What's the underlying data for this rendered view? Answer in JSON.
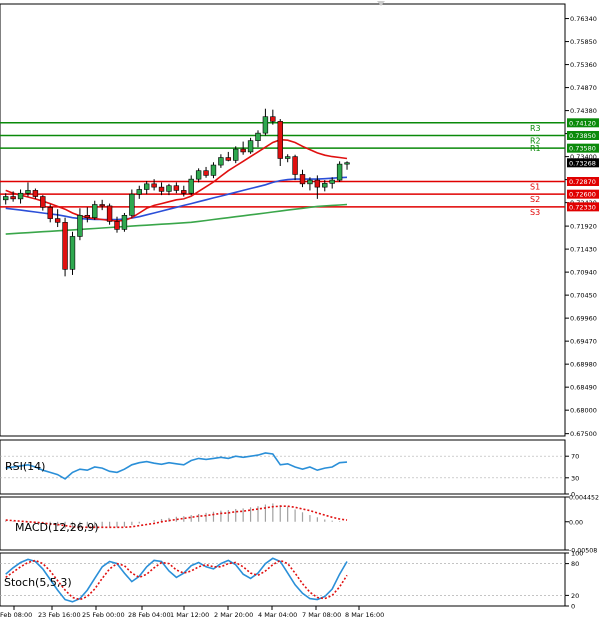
{
  "chart_data": {
    "type": "candlestick",
    "main": {
      "ylim": [
        0.6745,
        0.7665
      ],
      "y_ticks": [
        "0.76340",
        "0.75850",
        "0.75360",
        "0.74870",
        "0.74380",
        "0.73890",
        "0.73400",
        "0.72910",
        "0.72420",
        "0.71920",
        "0.71430",
        "0.70940",
        "0.70450",
        "0.69960",
        "0.69470",
        "0.68980",
        "0.68490",
        "0.68000",
        "0.67500"
      ],
      "last_price": {
        "value": 0.73268,
        "label": "0.73268"
      },
      "levels": [
        {
          "name": "R3",
          "value": 0.7412,
          "label": "0.74120",
          "color": "#0a8a0a"
        },
        {
          "name": "R2",
          "value": 0.7385,
          "label": "0.73850",
          "color": "#0a8a0a"
        },
        {
          "name": "R1",
          "value": 0.7358,
          "label": "0.73580",
          "color": "#0a8a0a"
        },
        {
          "name": "S1",
          "value": 0.7287,
          "label": "0.72870",
          "color": "#e00000"
        },
        {
          "name": "S2",
          "value": 0.726,
          "label": "0.72600",
          "color": "#e00000"
        },
        {
          "name": "S3",
          "value": 0.7233,
          "label": "0.72330",
          "color": "#e00000"
        }
      ],
      "candles": [
        {
          "o": 0.7248,
          "h": 0.7262,
          "l": 0.7238,
          "c": 0.7255
        },
        {
          "o": 0.7255,
          "h": 0.7266,
          "l": 0.7244,
          "c": 0.725
        },
        {
          "o": 0.725,
          "h": 0.727,
          "l": 0.724,
          "c": 0.7262
        },
        {
          "o": 0.7262,
          "h": 0.7285,
          "l": 0.7255,
          "c": 0.7268
        },
        {
          "o": 0.7268,
          "h": 0.7272,
          "l": 0.725,
          "c": 0.7255
        },
        {
          "o": 0.7255,
          "h": 0.7258,
          "l": 0.7225,
          "c": 0.7232
        },
        {
          "o": 0.7232,
          "h": 0.7238,
          "l": 0.72,
          "c": 0.7208
        },
        {
          "o": 0.7208,
          "h": 0.7228,
          "l": 0.719,
          "c": 0.72
        },
        {
          "o": 0.72,
          "h": 0.721,
          "l": 0.7085,
          "c": 0.71
        },
        {
          "o": 0.71,
          "h": 0.718,
          "l": 0.7088,
          "c": 0.717
        },
        {
          "o": 0.717,
          "h": 0.723,
          "l": 0.7162,
          "c": 0.7215
        },
        {
          "o": 0.7215,
          "h": 0.7232,
          "l": 0.72,
          "c": 0.721
        },
        {
          "o": 0.721,
          "h": 0.7246,
          "l": 0.7205,
          "c": 0.7238
        },
        {
          "o": 0.7238,
          "h": 0.7248,
          "l": 0.7226,
          "c": 0.7235
        },
        {
          "o": 0.7235,
          "h": 0.724,
          "l": 0.7195,
          "c": 0.7202
        },
        {
          "o": 0.7202,
          "h": 0.7212,
          "l": 0.7178,
          "c": 0.7185
        },
        {
          "o": 0.7185,
          "h": 0.722,
          "l": 0.718,
          "c": 0.7215
        },
        {
          "o": 0.7215,
          "h": 0.727,
          "l": 0.721,
          "c": 0.726
        },
        {
          "o": 0.726,
          "h": 0.7278,
          "l": 0.725,
          "c": 0.727
        },
        {
          "o": 0.727,
          "h": 0.7288,
          "l": 0.726,
          "c": 0.7282
        },
        {
          "o": 0.7282,
          "h": 0.7292,
          "l": 0.7268,
          "c": 0.7275
        },
        {
          "o": 0.7275,
          "h": 0.7285,
          "l": 0.7258,
          "c": 0.7266
        },
        {
          "o": 0.7266,
          "h": 0.7282,
          "l": 0.7258,
          "c": 0.7278
        },
        {
          "o": 0.7278,
          "h": 0.7285,
          "l": 0.7262,
          "c": 0.7268
        },
        {
          "o": 0.7268,
          "h": 0.7278,
          "l": 0.7255,
          "c": 0.7262
        },
        {
          "o": 0.7262,
          "h": 0.73,
          "l": 0.7258,
          "c": 0.7292
        },
        {
          "o": 0.7292,
          "h": 0.7315,
          "l": 0.7285,
          "c": 0.731
        },
        {
          "o": 0.731,
          "h": 0.7318,
          "l": 0.7295,
          "c": 0.73
        },
        {
          "o": 0.73,
          "h": 0.7328,
          "l": 0.7294,
          "c": 0.7322
        },
        {
          "o": 0.7322,
          "h": 0.7345,
          "l": 0.7316,
          "c": 0.7338
        },
        {
          "o": 0.7338,
          "h": 0.735,
          "l": 0.733,
          "c": 0.7332
        },
        {
          "o": 0.7332,
          "h": 0.7362,
          "l": 0.7326,
          "c": 0.7356
        },
        {
          "o": 0.7356,
          "h": 0.7372,
          "l": 0.7344,
          "c": 0.735
        },
        {
          "o": 0.735,
          "h": 0.738,
          "l": 0.7346,
          "c": 0.7374
        },
        {
          "o": 0.7374,
          "h": 0.7396,
          "l": 0.736,
          "c": 0.739
        },
        {
          "o": 0.739,
          "h": 0.7442,
          "l": 0.7385,
          "c": 0.7425
        },
        {
          "o": 0.7425,
          "h": 0.744,
          "l": 0.7408,
          "c": 0.7415
        },
        {
          "o": 0.7415,
          "h": 0.742,
          "l": 0.732,
          "c": 0.7336
        },
        {
          "o": 0.7336,
          "h": 0.7345,
          "l": 0.7328,
          "c": 0.734
        },
        {
          "o": 0.734,
          "h": 0.7344,
          "l": 0.729,
          "c": 0.7302
        },
        {
          "o": 0.7302,
          "h": 0.7312,
          "l": 0.7275,
          "c": 0.7282
        },
        {
          "o": 0.7282,
          "h": 0.7296,
          "l": 0.7268,
          "c": 0.729
        },
        {
          "o": 0.729,
          "h": 0.73,
          "l": 0.725,
          "c": 0.7275
        },
        {
          "o": 0.7275,
          "h": 0.729,
          "l": 0.7266,
          "c": 0.7283
        },
        {
          "o": 0.7283,
          "h": 0.7296,
          "l": 0.7272,
          "c": 0.729
        },
        {
          "o": 0.729,
          "h": 0.733,
          "l": 0.7286,
          "c": 0.7324
        },
        {
          "o": 0.7324,
          "h": 0.733,
          "l": 0.7312,
          "c": 0.7327
        }
      ],
      "ma_red": [
        0.7268,
        0.7262,
        0.7258,
        0.7254,
        0.725,
        0.7245,
        0.724,
        0.7234,
        0.7228,
        0.722,
        0.7214,
        0.721,
        0.7208,
        0.7206,
        0.7204,
        0.7203,
        0.7204,
        0.721,
        0.722,
        0.723,
        0.7236,
        0.724,
        0.7244,
        0.7248,
        0.725,
        0.7256,
        0.7266,
        0.7276,
        0.7286,
        0.7298,
        0.731,
        0.732,
        0.733,
        0.734,
        0.735,
        0.736,
        0.737,
        0.7376,
        0.7375,
        0.737,
        0.7362,
        0.7355,
        0.7348,
        0.7343,
        0.734,
        0.7338,
        0.7336
      ],
      "ma_blue": [
        0.723,
        0.7228,
        0.7226,
        0.7224,
        0.7222,
        0.722,
        0.7218,
        0.7216,
        0.7213,
        0.721,
        0.7208,
        0.7207,
        0.7206,
        0.7206,
        0.7206,
        0.7206,
        0.7207,
        0.7209,
        0.7212,
        0.7216,
        0.722,
        0.7224,
        0.7228,
        0.7232,
        0.7236,
        0.724,
        0.7244,
        0.7248,
        0.7252,
        0.7256,
        0.726,
        0.7264,
        0.7268,
        0.7272,
        0.7276,
        0.728,
        0.7285,
        0.7289,
        0.7291,
        0.7292,
        0.7292,
        0.7292,
        0.7292,
        0.7293,
        0.7294,
        0.7295,
        0.7296
      ],
      "ma_green": [
        0.7175,
        0.7176,
        0.7177,
        0.7178,
        0.7179,
        0.718,
        0.7181,
        0.7182,
        0.7183,
        0.7184,
        0.7185,
        0.7186,
        0.7187,
        0.7188,
        0.7189,
        0.719,
        0.7191,
        0.7192,
        0.7193,
        0.7194,
        0.7195,
        0.7196,
        0.7197,
        0.7198,
        0.7199,
        0.72,
        0.7202,
        0.7204,
        0.7206,
        0.7208,
        0.721,
        0.7212,
        0.7214,
        0.7216,
        0.7218,
        0.722,
        0.7222,
        0.7224,
        0.7226,
        0.7228,
        0.723,
        0.7232,
        0.7234,
        0.7235,
        0.7236,
        0.7237,
        0.7238
      ]
    },
    "x_labels": [
      "Feb 08:00",
      "23 Feb 16:00",
      "25 Feb 00:00",
      "28 Feb 04:00",
      "1 Mar 12:00",
      "2 Mar 20:00",
      "4 Mar 04:00",
      "7 Mar 08:00",
      "8 Mar 16:00"
    ],
    "rsi": {
      "label": "RSI(14)",
      "ylim": [
        0,
        100
      ],
      "ticks": [
        "70",
        "30",
        "0"
      ],
      "values": [
        48,
        50,
        52,
        54,
        50,
        44,
        40,
        36,
        28,
        40,
        46,
        44,
        50,
        48,
        42,
        40,
        46,
        54,
        58,
        60,
        57,
        55,
        58,
        56,
        54,
        62,
        66,
        64,
        66,
        68,
        66,
        70,
        68,
        70,
        72,
        76,
        74,
        54,
        56,
        50,
        46,
        50,
        44,
        48,
        50,
        58,
        59
      ]
    },
    "macd": {
      "label": "MACD(12,26,9)",
      "ticks": [
        "0.004452",
        "0.00",
        "-0.00508"
      ],
      "ylim": [
        -0.00508,
        0.004452
      ],
      "hist": [
        0.0002,
        0.0001,
        0.0,
        -0.0001,
        -0.0002,
        -0.0004,
        -0.0006,
        -0.0008,
        -0.0012,
        -0.0013,
        -0.0012,
        -0.0011,
        -0.001,
        -0.0009,
        -0.0009,
        -0.001,
        -0.0009,
        -0.0006,
        -0.0003,
        0.0,
        0.0003,
        0.0005,
        0.0007,
        0.0009,
        0.001,
        0.0012,
        0.0014,
        0.0016,
        0.0018,
        0.002,
        0.0021,
        0.0023,
        0.0024,
        0.0026,
        0.0028,
        0.0031,
        0.0033,
        0.003,
        0.0027,
        0.0022,
        0.0017,
        0.0012,
        0.0008,
        0.0004,
        0.0002,
        0.0001,
        0.0
      ],
      "signal": [
        0.0003,
        0.0002,
        0.0001,
        0.0,
        -0.0001,
        -0.0002,
        -0.0004,
        -0.0005,
        -0.0007,
        -0.0009,
        -0.001,
        -0.001,
        -0.001,
        -0.001,
        -0.001,
        -0.001,
        -0.001,
        -0.0009,
        -0.0007,
        -0.0005,
        -0.0003,
        0.0,
        0.0002,
        0.0004,
        0.0006,
        0.0008,
        0.001,
        0.0011,
        0.0013,
        0.0015,
        0.0016,
        0.0018,
        0.0019,
        0.0021,
        0.0023,
        0.0025,
        0.0027,
        0.0028,
        0.0028,
        0.0026,
        0.0023,
        0.002,
        0.0016,
        0.0012,
        0.0008,
        0.0005,
        0.0003
      ]
    },
    "stoch": {
      "label": "Stoch(5,5,3)",
      "ylim": [
        0,
        100
      ],
      "ticks": [
        "100",
        "80",
        "20",
        "0"
      ],
      "k": [
        60,
        72,
        82,
        88,
        84,
        70,
        50,
        30,
        12,
        8,
        14,
        30,
        52,
        74,
        84,
        80,
        62,
        46,
        56,
        74,
        86,
        84,
        66,
        54,
        62,
        76,
        82,
        74,
        70,
        80,
        86,
        78,
        60,
        52,
        62,
        80,
        90,
        84,
        62,
        40,
        24,
        14,
        12,
        18,
        32,
        60,
        84
      ],
      "d": [
        54,
        64,
        74,
        82,
        86,
        80,
        66,
        48,
        30,
        16,
        12,
        18,
        32,
        52,
        70,
        80,
        76,
        62,
        54,
        60,
        72,
        82,
        80,
        68,
        62,
        66,
        74,
        78,
        74,
        74,
        80,
        82,
        74,
        62,
        58,
        66,
        78,
        86,
        80,
        62,
        42,
        26,
        16,
        14,
        20,
        36,
        58
      ]
    }
  }
}
